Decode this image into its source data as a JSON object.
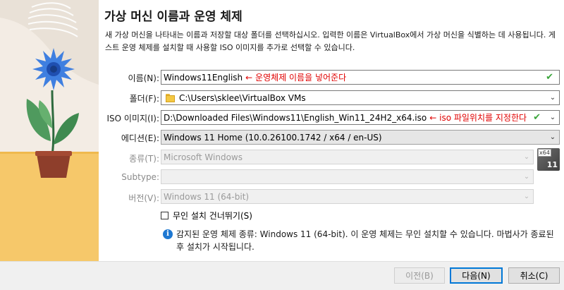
{
  "header": {
    "title": "가상 머신 이름과 운영 체제",
    "description": "새 가상 머신을 나타내는 이름과 저장할 대상 폴더를 선택하십시오. 입력한 이름은 VirtualBox에서 가상 머신을 식별하는 데 사용됩니다. 게스트 운영 체제를 설치할 때 사용할 ISO 이미지를 추가로 선택할 수 있습니다."
  },
  "form": {
    "name": {
      "label": "이름(N):",
      "value": "Windows11English",
      "annotation": "← 운영체제 이름을 넣어준다"
    },
    "folder": {
      "label": "폴더(F):",
      "value": "C:\\Users\\sklee\\VirtualBox VMs"
    },
    "iso": {
      "label": "ISO 이미지(I):",
      "value": "D:\\Downloaded Files\\Windows11\\English_Win11_24H2_x64.iso",
      "annotation": "← iso 파일위치를 지정한다"
    },
    "edition": {
      "label": "에디션(E):",
      "value": "Windows 11 Home (10.0.26100.1742 / x64 / en-US)"
    },
    "type": {
      "label": "종류(T):",
      "value": "Microsoft Windows"
    },
    "subtype": {
      "label": "Subtype:",
      "value": ""
    },
    "version": {
      "label": "버전(V):",
      "value": "Windows 11 (64-bit)"
    },
    "os_badge": {
      "arch": "x64",
      "number": "11"
    },
    "unattended": {
      "label": "무인 설치 건너뛰기(S)",
      "checked": false
    },
    "info_text": "감지된 운영 체제 종류: Windows 11 (64-bit). 이 운영 체제는 무인 설치할 수 있습니다. 마법사가 종료된 후 설치가 시작됩니다."
  },
  "buttons": {
    "back": "이전(B)",
    "next": "다음(N)",
    "cancel": "취소(C)"
  },
  "colors": {
    "annotation": "#e00000",
    "check": "#3aa53a",
    "default_button_border": "#0078d7",
    "info_icon": "#1e78d2"
  }
}
